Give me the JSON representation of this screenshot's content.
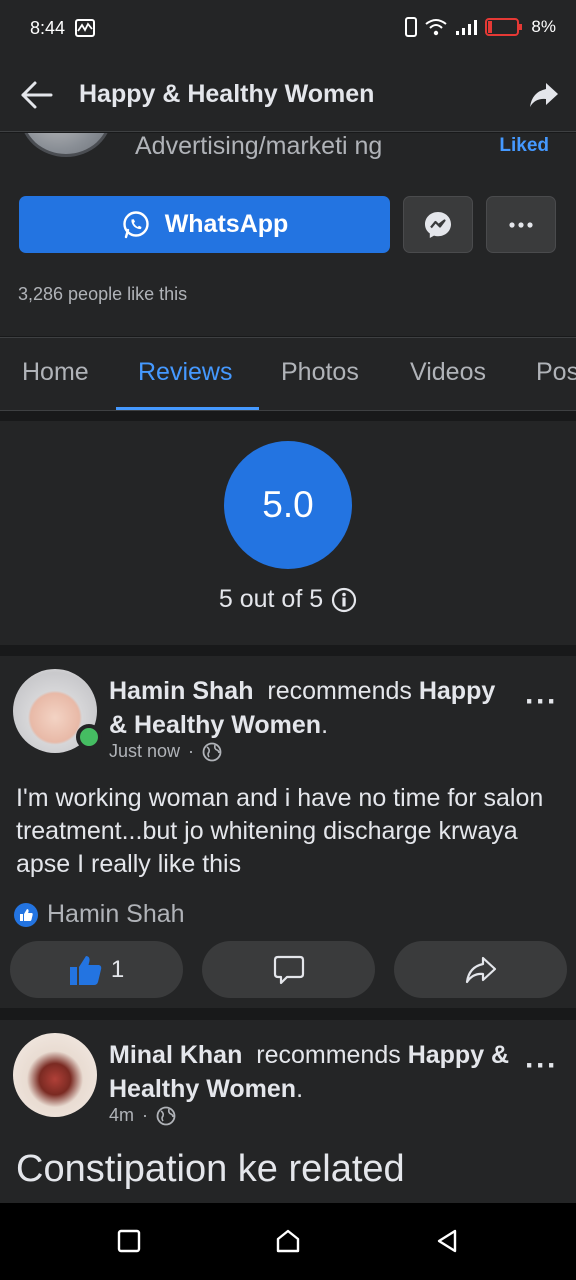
{
  "status_bar": {
    "time": "8:44",
    "battery": "8%"
  },
  "topbar": {
    "title": "Happy & Healthy Women"
  },
  "page_header": {
    "category": "Advertising/marketi ng",
    "liked_label": "Liked",
    "whatsapp_label": "WhatsApp",
    "likes_count": "3,286 people like this"
  },
  "tabs": [
    {
      "label": "Home",
      "active": false
    },
    {
      "label": "Reviews",
      "active": true
    },
    {
      "label": "Photos",
      "active": false
    },
    {
      "label": "Videos",
      "active": false
    },
    {
      "label": "Pos",
      "active": false
    }
  ],
  "rating": {
    "score": "5.0",
    "summary": "5 out of 5"
  },
  "reviews": [
    {
      "name": "Hamin Shah",
      "verb": "recommends",
      "page": "Happy & Healthy Women",
      "time": "Just now",
      "body": "I'm working woman and i have no time for salon treatment...but jo whitening discharge krwaya apse  I really like this",
      "reactor": "Hamin Shah",
      "like_count": "1"
    },
    {
      "name": "Minal Khan",
      "verb": "recommends",
      "page": "Happy & Healthy Women",
      "time": "4m",
      "body": "Constipation ke related"
    }
  ],
  "colors": {
    "accent": "#2374e1",
    "link": "#4599ff",
    "online": "#45bd62",
    "background": "#18191a",
    "card": "#242526"
  },
  "icons": [
    "back-arrow-icon",
    "share-icon",
    "whatsapp-icon",
    "messenger-icon",
    "more-icon",
    "info-icon",
    "globe-icon",
    "like-icon",
    "comment-icon",
    "square-icon",
    "home-circle-icon",
    "back-triangle-icon"
  ]
}
